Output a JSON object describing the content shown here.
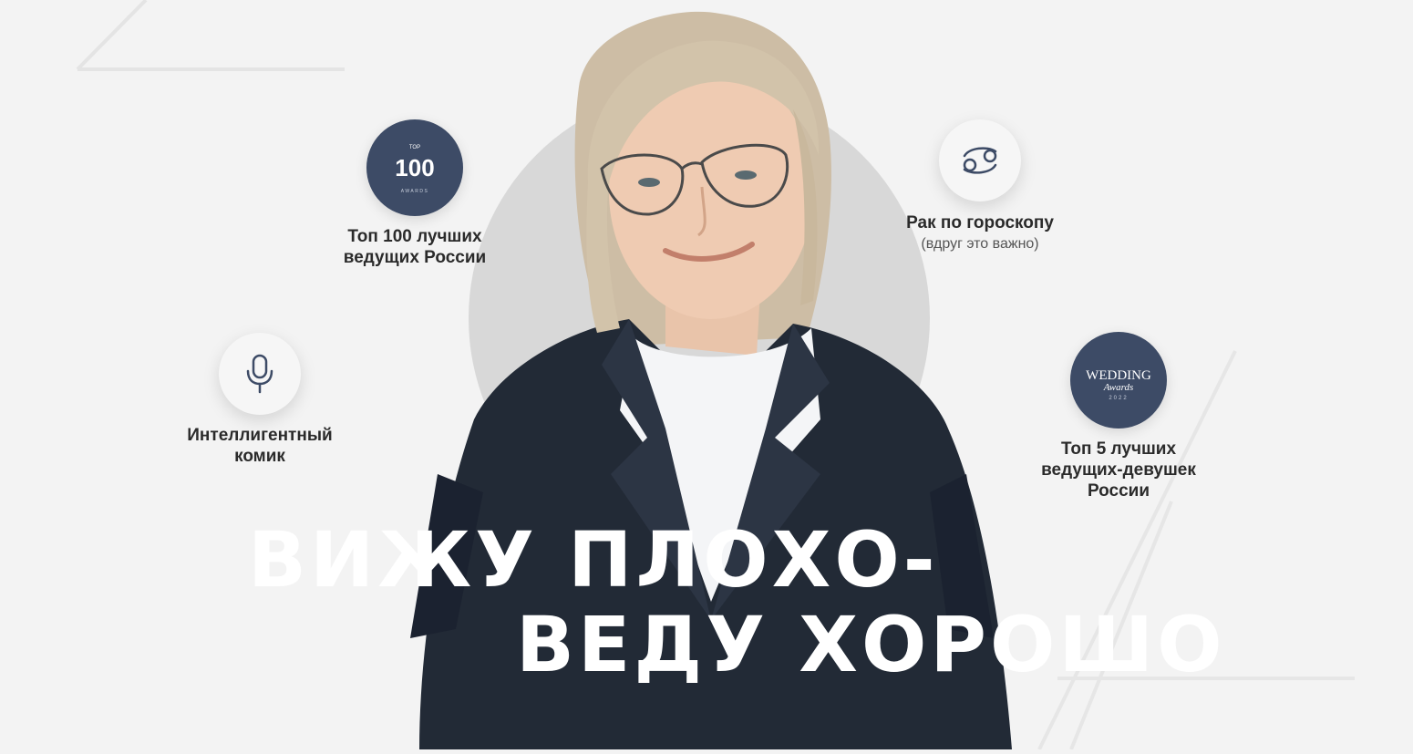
{
  "features": {
    "top100": {
      "line1": "Топ 100 лучших",
      "line2": "ведущих России",
      "badge_small": "TOP",
      "badge_number": "100",
      "badge_caption": "AWARDS"
    },
    "comic": {
      "line1": "Интеллигентный",
      "line2": "комик"
    },
    "zodiac": {
      "title": "Рак по гороскопу",
      "subtitle": "(вдруг это важно)"
    },
    "wedding": {
      "line1": "Топ 5 лучших",
      "line2": "ведущих-девушек",
      "line3": "России",
      "badge_title": "WEDDING",
      "badge_script": "Awards",
      "badge_year": "2022"
    }
  },
  "headline": {
    "line1": "ВИЖУ ПЛОХО-",
    "line2": "ВЕДУ ХОРОШО"
  },
  "colors": {
    "badge_dark": "#3d4b66",
    "background": "#f3f3f3",
    "circle": "#d8d8d8",
    "icon_stroke": "#3d4b66"
  },
  "icons": {
    "top100_badge": "top-100-awards-logo",
    "comic": "microphone-icon",
    "zodiac": "cancer-zodiac-icon",
    "wedding_badge": "wedding-awards-logo"
  }
}
